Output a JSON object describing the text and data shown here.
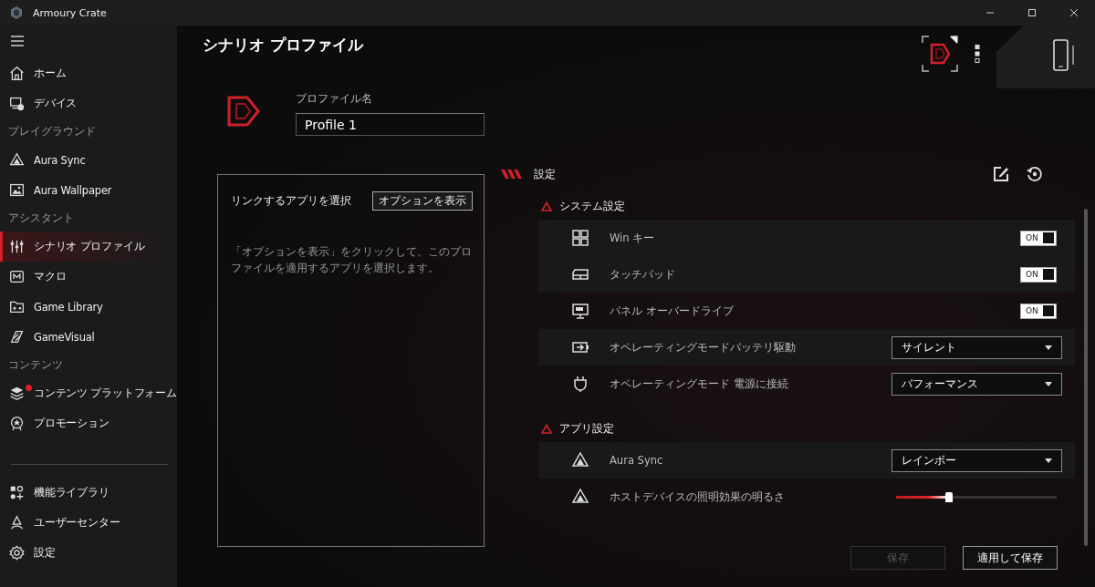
{
  "window": {
    "title": "Armoury Crate"
  },
  "sidebar": {
    "groups": [
      {
        "items": [
          {
            "label": "ホーム",
            "selected": false,
            "badge": false
          },
          {
            "label": "デバイス",
            "selected": false,
            "badge": false
          }
        ]
      },
      {
        "heading": "プレイグラウンド",
        "items": [
          {
            "label": "Aura Sync",
            "selected": false,
            "badge": false
          },
          {
            "label": "Aura Wallpaper",
            "selected": false,
            "badge": false
          }
        ]
      },
      {
        "heading": "アシスタント",
        "items": [
          {
            "label": "シナリオ プロファイル",
            "selected": true,
            "badge": false
          },
          {
            "label": "マクロ",
            "selected": false,
            "badge": false
          },
          {
            "label": "Game Library",
            "selected": false,
            "badge": false
          },
          {
            "label": "GameVisual",
            "selected": false,
            "badge": false
          }
        ]
      },
      {
        "heading": "コンテンツ",
        "items": [
          {
            "label": "コンテンツ プラットフォーム",
            "selected": false,
            "badge": true
          },
          {
            "label": "プロモーション",
            "selected": false,
            "badge": false
          }
        ]
      }
    ],
    "footer": [
      {
        "label": "機能ライブラリ",
        "selected": false,
        "badge": false
      },
      {
        "label": "ユーザーセンター",
        "selected": false,
        "badge": false
      },
      {
        "label": "設定",
        "selected": false,
        "badge": false
      }
    ]
  },
  "page": {
    "title": "シナリオ プロファイル"
  },
  "profile": {
    "name_label": "プロファイル名",
    "name": "Profile 1"
  },
  "link_panel": {
    "title": "リンクするアプリを選択",
    "button": "オプションを表示",
    "hint": "「オプションを表示」をクリックして、このプロファイルを適用するアプリを選択します。"
  },
  "settings": {
    "title": "設定",
    "sections": [
      {
        "title": "システム設定",
        "rows": [
          {
            "kind": "toggle",
            "label": "Win キー",
            "on": true,
            "toggle_text": "ON"
          },
          {
            "kind": "toggle",
            "label": "タッチパッド",
            "on": true,
            "toggle_text": "ON"
          },
          {
            "kind": "toggle",
            "label": "パネル オーバードライブ",
            "on": true,
            "toggle_text": "ON"
          },
          {
            "kind": "select",
            "label": "オペレーティングモードバッテリ駆動",
            "value": "サイレント"
          },
          {
            "kind": "select",
            "label": "オペレーティングモード 電源に接続",
            "value": "パフォーマンス"
          }
        ]
      },
      {
        "title": "アプリ設定",
        "rows": [
          {
            "kind": "select",
            "label": "Aura Sync",
            "value": "レインボー"
          },
          {
            "kind": "slider",
            "label": "ホストデバイスの照明効果の明るさ",
            "level": 0.33
          }
        ]
      }
    ]
  },
  "buttons": [
    {
      "label": "保存",
      "disabled": true
    },
    {
      "label": "適用して保存",
      "disabled": false
    }
  ]
}
